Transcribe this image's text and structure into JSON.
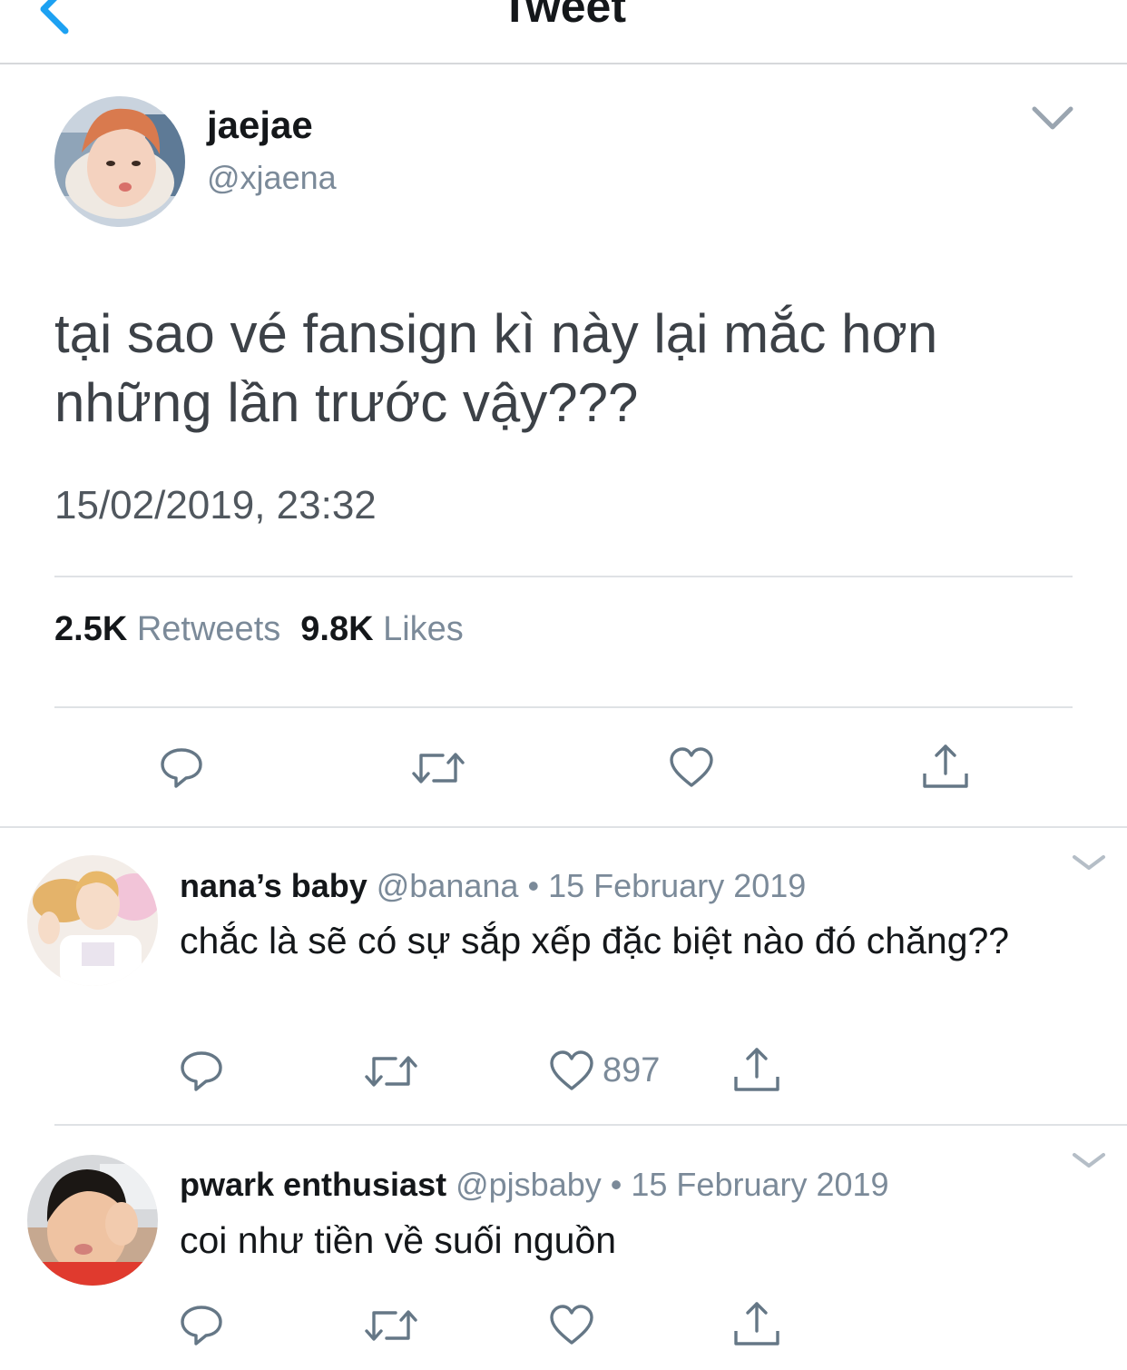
{
  "nav": {
    "title": "Tweet"
  },
  "tweet": {
    "name": "jaejae",
    "handle": "@xjaena",
    "text": "tại sao vé fansign kì này lại mắc hơn những lần trước vậy???",
    "timestamp": "15/02/2019, 23:32",
    "retweets_count": "2.5K",
    "retweets_label": "Retweets",
    "likes_count": "9.8K",
    "likes_label": "Likes"
  },
  "replies": [
    {
      "name": "nana’s baby",
      "handle": "@banana",
      "separator": "•",
      "date": "15 February 2019",
      "text": "chắc là sẽ có sự sắp xếp đặc biệt nào đó chăng??",
      "like_count": "897"
    },
    {
      "name": "pwark enthusiast",
      "handle": "@pjsbaby",
      "separator": "•",
      "date": "15 February 2019",
      "text": "coi như tiền về suối nguồn"
    }
  ],
  "icons": {
    "back": "chevron-left-icon",
    "menu": "chevron-down-icon",
    "reply": "reply-icon",
    "retweet": "retweet-icon",
    "like": "heart-icon",
    "share": "share-icon"
  },
  "colors": {
    "accent": "#1da1f2",
    "icon": "#657786",
    "muted_text": "#7b8a99",
    "divider": "#dfe2e5"
  }
}
